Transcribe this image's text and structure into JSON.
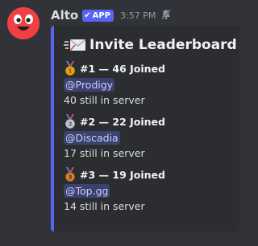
{
  "message": {
    "username": "Alto",
    "app_badge": "APP",
    "timestamp": "3:57 PM",
    "avatar_color": "#f23f43"
  },
  "embed": {
    "accent_color": "#5865f2",
    "title_emoji": "envelope-with-arrow-icon",
    "title": "Invite Leaderboard",
    "entries": [
      {
        "medal": "first-place-medal-icon",
        "rank_text": "#1 — 46 Joined",
        "mention": "@Prodigy",
        "still_text": "40 still in server"
      },
      {
        "medal": "second-place-medal-icon",
        "rank_text": "#2 — 22 Joined",
        "mention": "@Discadia",
        "still_text": "17 still in server"
      },
      {
        "medal": "third-place-medal-icon",
        "rank_text": "#3 — 19 Joined",
        "mention": "@Top.gg",
        "still_text": "14 still in server"
      }
    ]
  }
}
